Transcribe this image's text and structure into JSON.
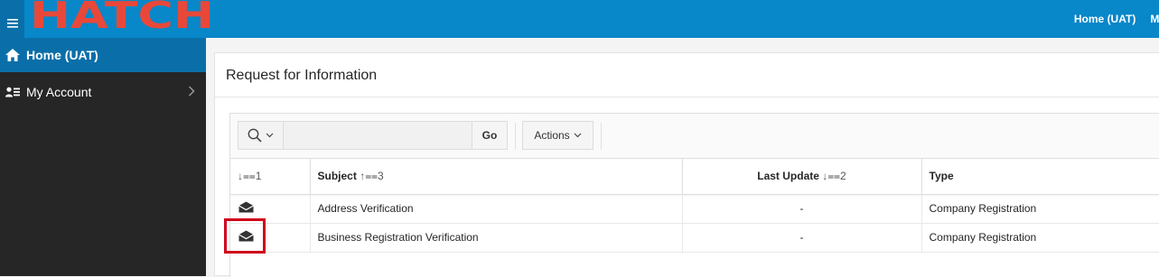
{
  "header": {
    "logo_text": "HATCH",
    "links": [
      "Home (UAT)",
      "My"
    ]
  },
  "sidebar": {
    "items": [
      {
        "label": "Home (UAT)",
        "icon": "home-icon",
        "active": true
      },
      {
        "label": "My Account",
        "icon": "user-list-icon",
        "active": false
      }
    ]
  },
  "main": {
    "region_title": "Request for Information",
    "toolbar": {
      "search_value": "",
      "go_label": "Go",
      "actions_label": "Actions"
    },
    "table": {
      "columns": [
        {
          "label": "",
          "sort": "↓⩵1"
        },
        {
          "label": "Subject",
          "sort": "↑⩵3"
        },
        {
          "label": "Last Update",
          "sort": "↓⩵2"
        },
        {
          "label": "Type",
          "sort": ""
        }
      ],
      "rows": [
        {
          "icon": "envelope-open-icon",
          "subject": "Address Verification",
          "last_update": "-",
          "type": "Company Registration"
        },
        {
          "icon": "envelope-open-icon",
          "subject": "Business Registration Verification",
          "last_update": "-",
          "type": "Company Registration"
        }
      ]
    }
  },
  "colors": {
    "topbar": "#0887c9",
    "sidebar": "#262626",
    "active_nav": "#0a6fa8",
    "logo": "#e8483a",
    "highlight": "#d0021b"
  }
}
